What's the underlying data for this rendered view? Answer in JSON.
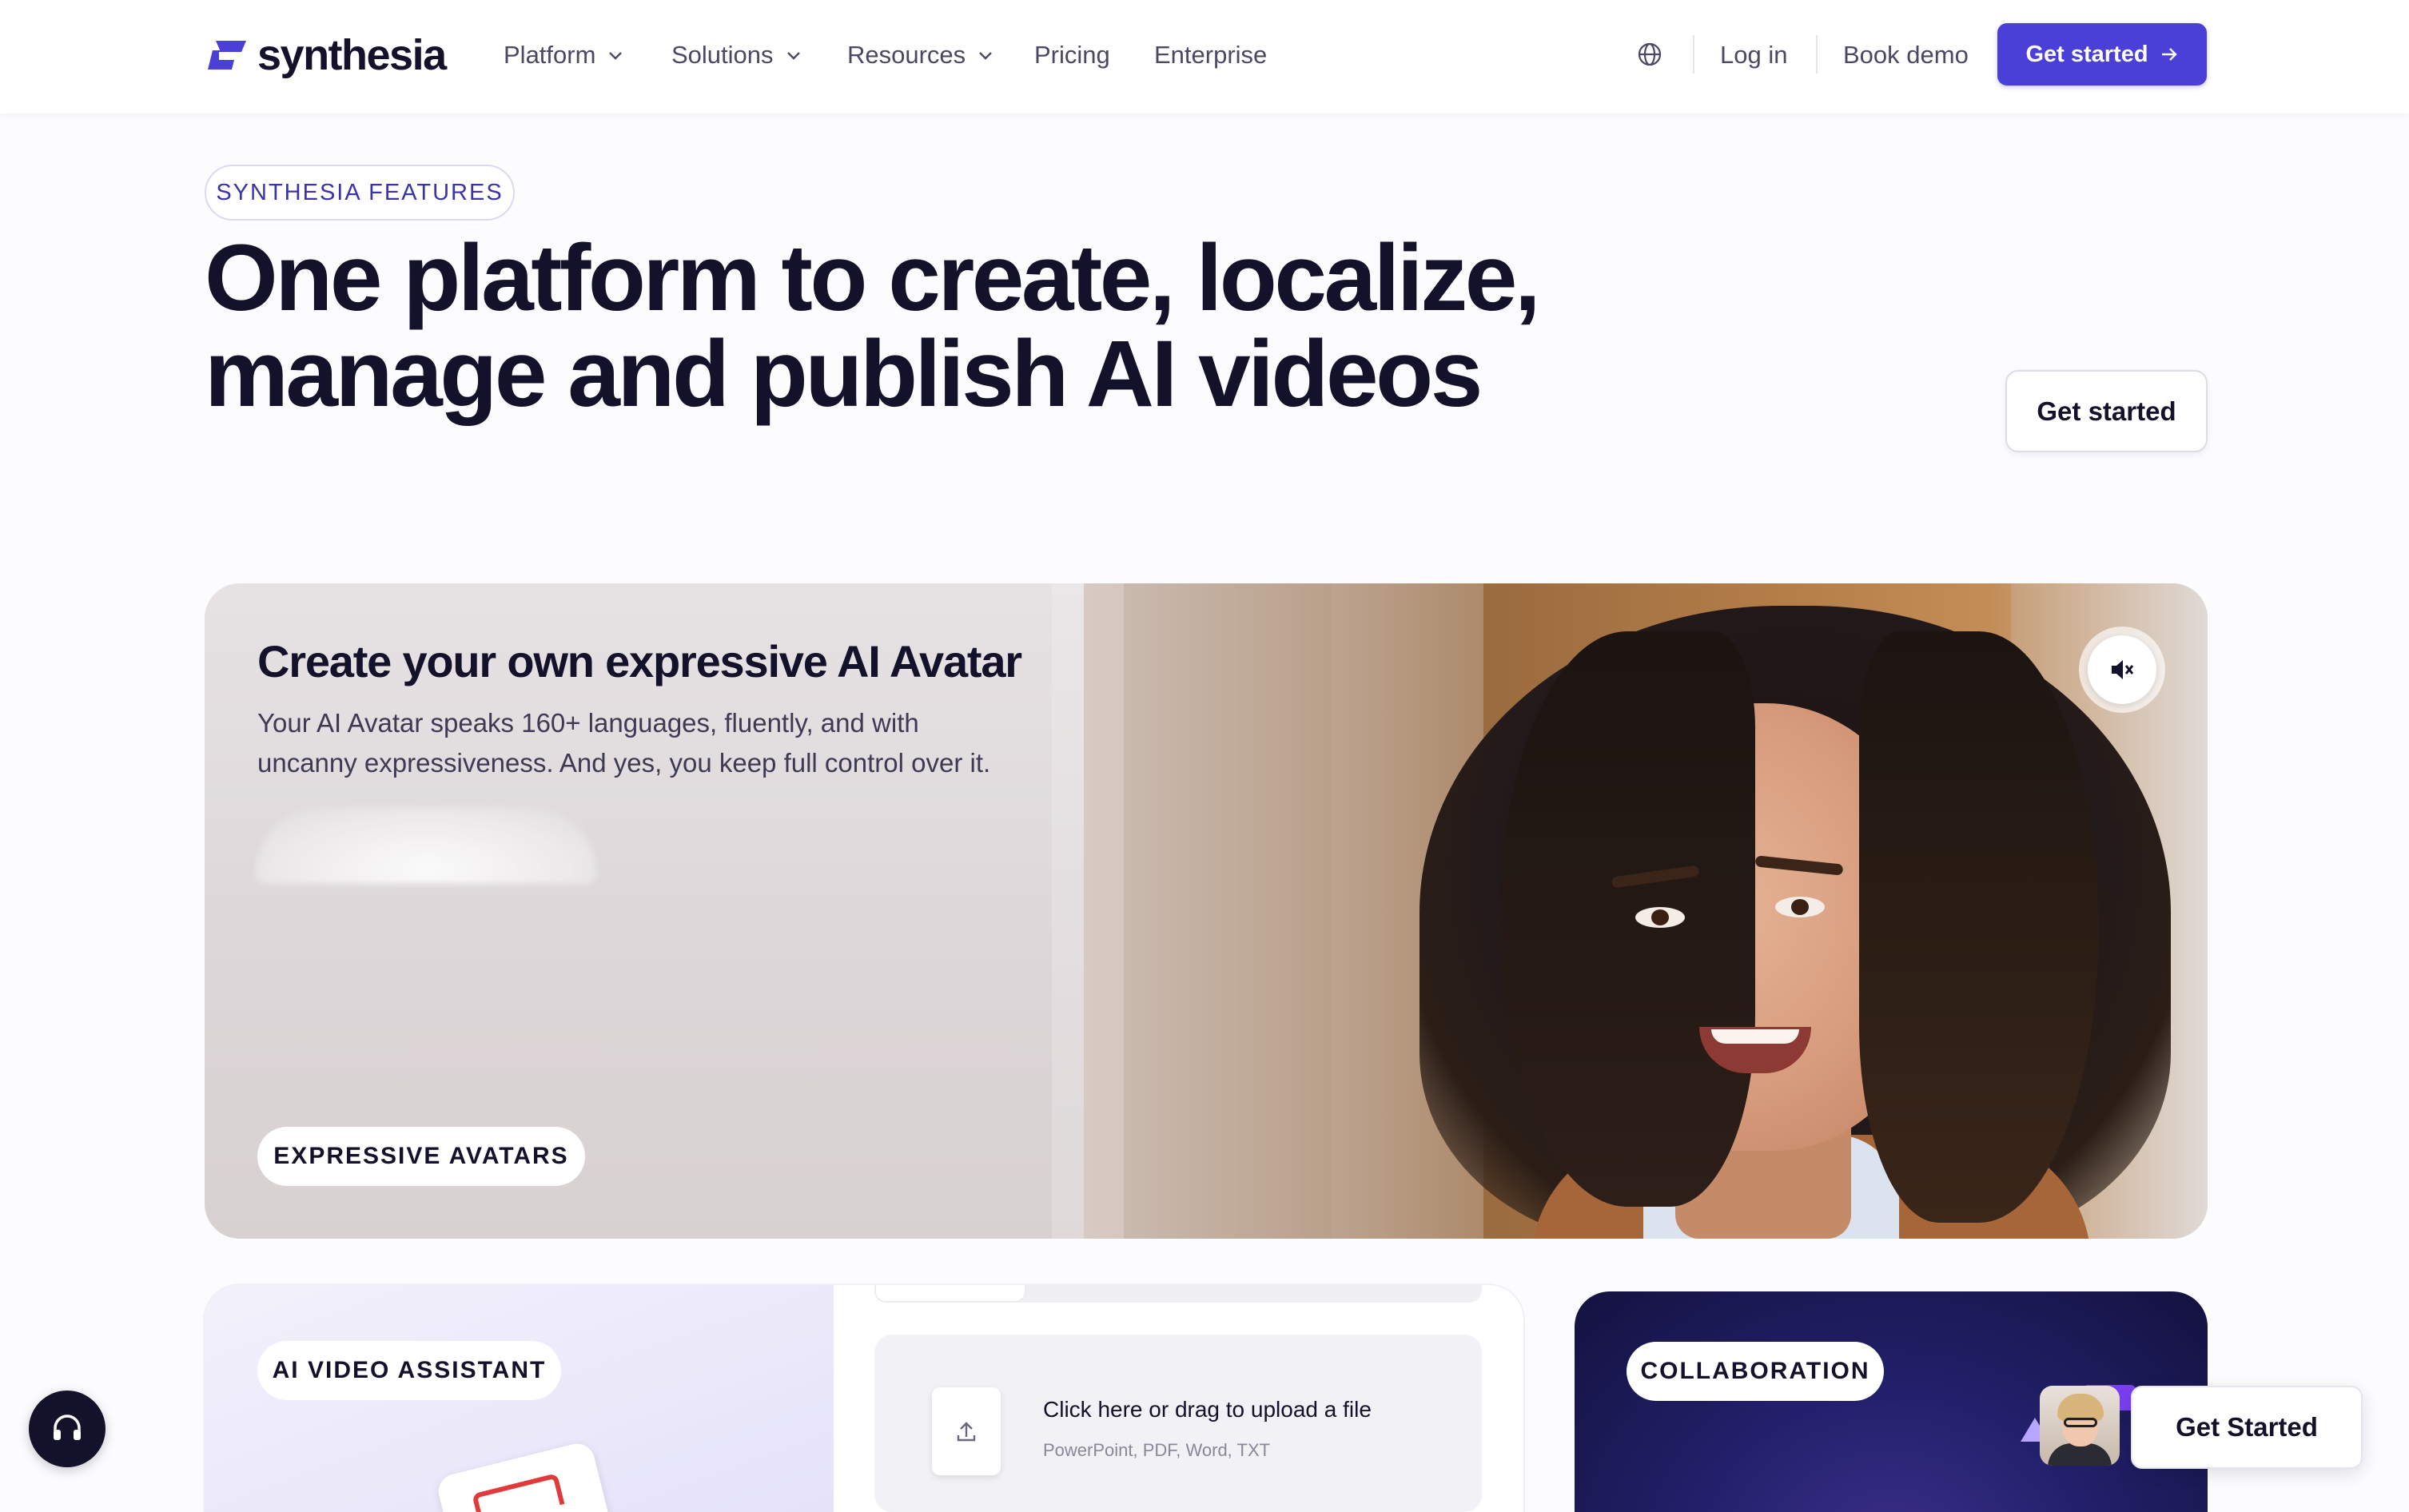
{
  "brand": {
    "name": "synthesia",
    "accent": "#4a3fd6",
    "dark": "#14112b"
  },
  "nav": {
    "items": [
      {
        "label": "Platform",
        "has_menu": true
      },
      {
        "label": "Solutions",
        "has_menu": true
      },
      {
        "label": "Resources",
        "has_menu": true
      },
      {
        "label": "Pricing",
        "has_menu": false
      },
      {
        "label": "Enterprise",
        "has_menu": false
      }
    ],
    "language_icon": "globe-icon",
    "login": "Log in",
    "book_demo": "Book demo",
    "get_started": "Get started"
  },
  "hero": {
    "eyebrow": "SYNTHESIA FEATURES",
    "title_line1": "One platform to create, localize,",
    "title_line2": "manage and publish AI videos",
    "cta": "Get started"
  },
  "avatar_card": {
    "title": "Create your own expressive AI Avatar",
    "desc_line1": "Your AI Avatar speaks 160+ languages, fluently, and with",
    "desc_line2": "uncanny expressiveness. And yes, you keep full control over it.",
    "chip": "EXPRESSIVE AVATARS",
    "mute_icon": "speaker-muted-icon"
  },
  "assistant_card": {
    "chip": "AI VIDEO ASSISTANT",
    "upload_text": "Click here or drag to upload a file",
    "upload_sub": "PowerPoint, PDF, Word, TXT",
    "upload_icon": "upload-icon"
  },
  "collab_card": {
    "chip": "COLLABORATION"
  },
  "floating_cta": "Get Started",
  "support_icon": "headset-icon"
}
